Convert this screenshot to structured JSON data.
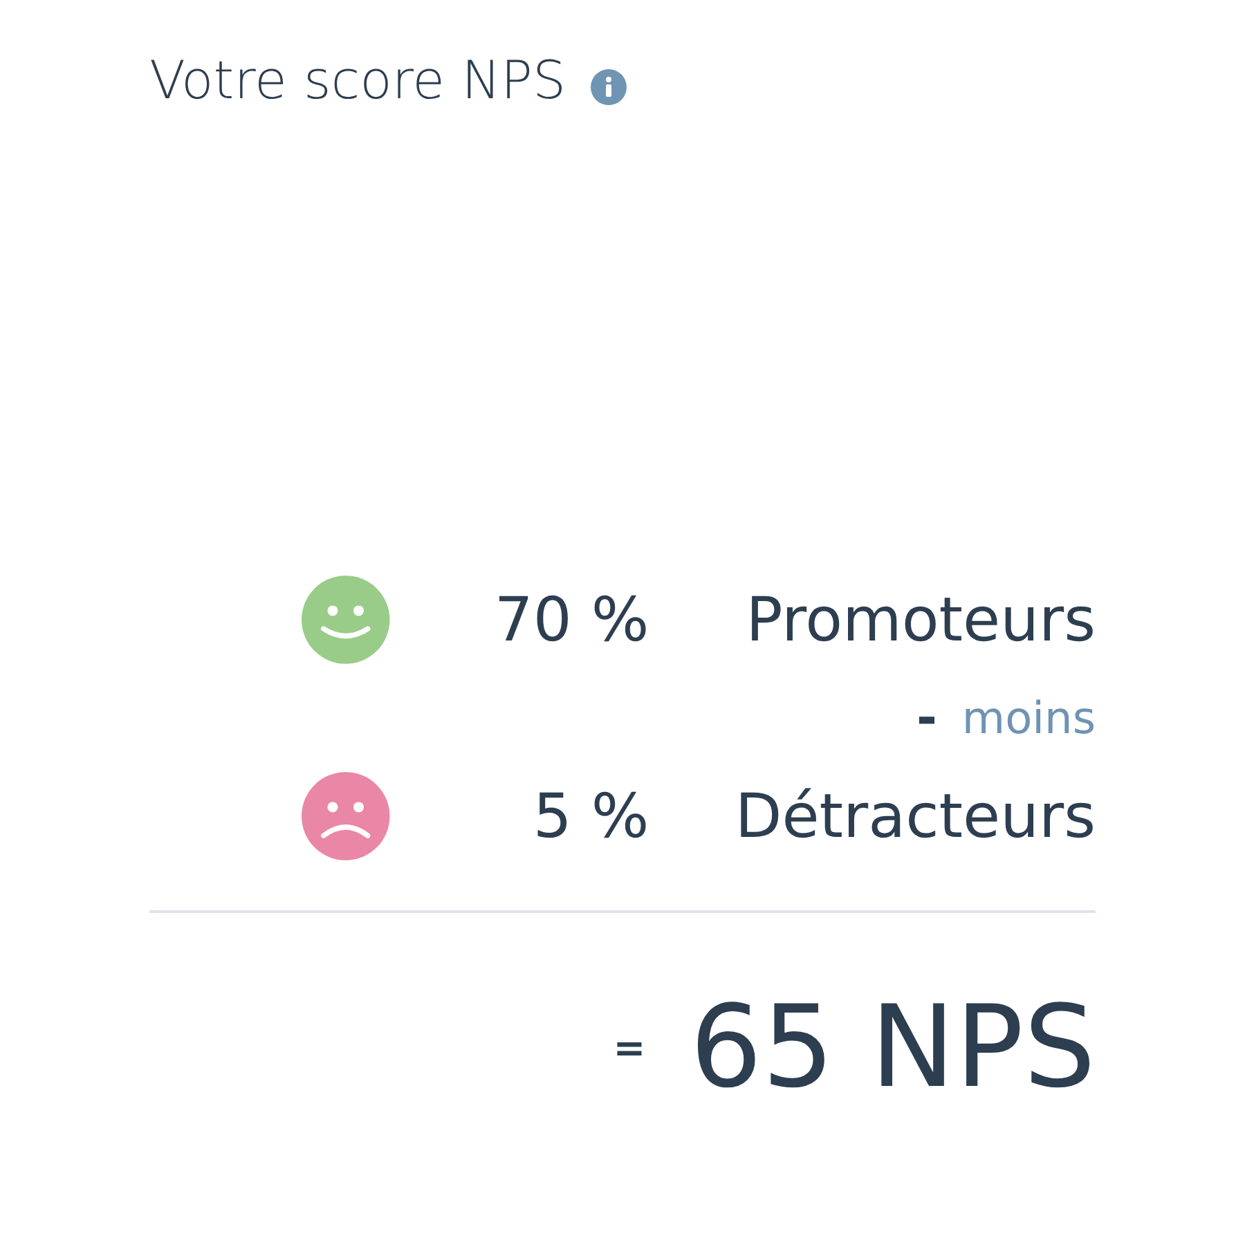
{
  "title": "Votre score NPS",
  "rows": [
    {
      "kind": "happy",
      "color": "#99cc88",
      "percent": "70 %",
      "label": "Promoteurs"
    },
    {
      "kind": "sad",
      "color": "#ea86a6",
      "percent": "5 %",
      "label": "Détracteurs"
    }
  ],
  "operator": {
    "symbol": "-",
    "text": "moins"
  },
  "result": {
    "symbol": "=",
    "value": "65 NPS"
  }
}
